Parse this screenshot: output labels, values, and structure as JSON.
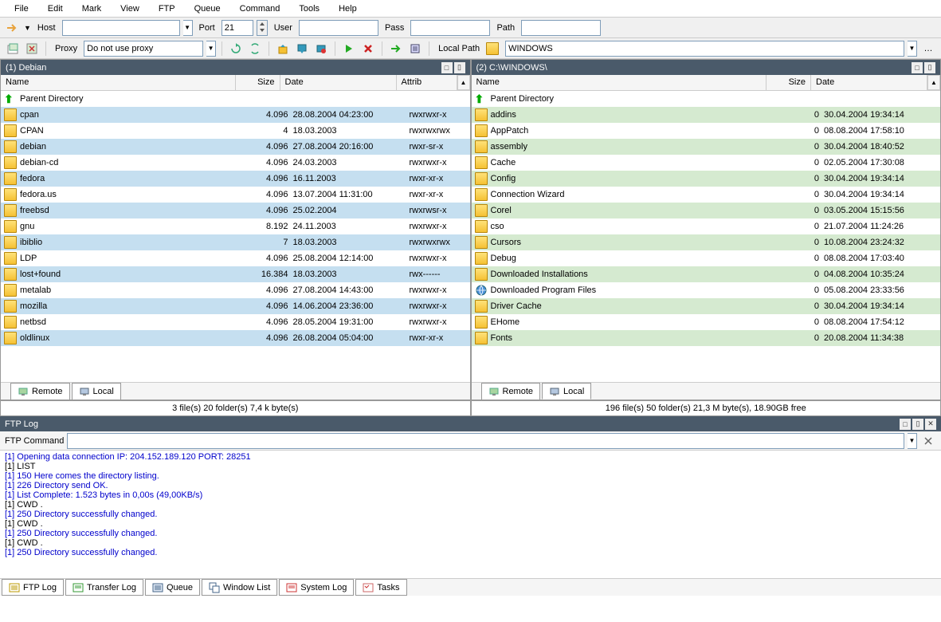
{
  "menu": {
    "file": "File",
    "edit": "Edit",
    "mark": "Mark",
    "view": "View",
    "ftp": "FTP",
    "queue": "Queue",
    "command": "Command",
    "tools": "Tools",
    "help": "Help"
  },
  "toolbar1": {
    "host": "Host",
    "port": "Port",
    "port_val": "21",
    "user": "User",
    "pass": "Pass",
    "path": "Path"
  },
  "toolbar2": {
    "proxy": "Proxy",
    "proxy_val": "Do not use proxy",
    "local_path": "Local Path",
    "local_path_val": "WINDOWS"
  },
  "left": {
    "title": "(1) Debian",
    "cols": {
      "name": "Name",
      "size": "Size",
      "date": "Date",
      "attrib": "Attrib"
    },
    "parent": "Parent Directory",
    "rows": [
      {
        "name": "cpan",
        "size": "4.096",
        "date": "28.08.2004 04:23:00",
        "attrib": "rwxrwxr-x"
      },
      {
        "name": "CPAN",
        "size": "4",
        "date": "18.03.2003",
        "attrib": "rwxrwxrwx"
      },
      {
        "name": "debian",
        "size": "4.096",
        "date": "27.08.2004 20:16:00",
        "attrib": "rwxr-sr-x"
      },
      {
        "name": "debian-cd",
        "size": "4.096",
        "date": "24.03.2003",
        "attrib": "rwxrwxr-x"
      },
      {
        "name": "fedora",
        "size": "4.096",
        "date": "16.11.2003",
        "attrib": "rwxr-xr-x"
      },
      {
        "name": "fedora.us",
        "size": "4.096",
        "date": "13.07.2004 11:31:00",
        "attrib": "rwxr-xr-x"
      },
      {
        "name": "freebsd",
        "size": "4.096",
        "date": "25.02.2004",
        "attrib": "rwxrwsr-x"
      },
      {
        "name": "gnu",
        "size": "8.192",
        "date": "24.11.2003",
        "attrib": "rwxrwxr-x"
      },
      {
        "name": "ibiblio",
        "size": "7",
        "date": "18.03.2003",
        "attrib": "rwxrwxrwx"
      },
      {
        "name": "LDP",
        "size": "4.096",
        "date": "25.08.2004 12:14:00",
        "attrib": "rwxrwxr-x"
      },
      {
        "name": "lost+found",
        "size": "16.384",
        "date": "18.03.2003",
        "attrib": "rwx------"
      },
      {
        "name": "metalab",
        "size": "4.096",
        "date": "27.08.2004 14:43:00",
        "attrib": "rwxrwxr-x"
      },
      {
        "name": "mozilla",
        "size": "4.096",
        "date": "14.06.2004 23:36:00",
        "attrib": "rwxrwxr-x"
      },
      {
        "name": "netbsd",
        "size": "4.096",
        "date": "28.05.2004 19:31:00",
        "attrib": "rwxrwxr-x"
      },
      {
        "name": "oldlinux",
        "size": "4.096",
        "date": "26.08.2004 05:04:00",
        "attrib": "rwxr-xr-x"
      }
    ],
    "tabs": {
      "remote": "Remote",
      "local": "Local"
    },
    "status": "3 file(s) 20 folder(s) 7,4 k byte(s)"
  },
  "right": {
    "title": "(2) C:\\WINDOWS\\",
    "cols": {
      "name": "Name",
      "size": "Size",
      "date": "Date"
    },
    "parent": "Parent Directory",
    "rows": [
      {
        "name": "addins",
        "size": "0",
        "date": "30.04.2004 19:34:14"
      },
      {
        "name": "AppPatch",
        "size": "0",
        "date": "08.08.2004 17:58:10"
      },
      {
        "name": "assembly",
        "size": "0",
        "date": "30.04.2004 18:40:52"
      },
      {
        "name": "Cache",
        "size": "0",
        "date": "02.05.2004 17:30:08"
      },
      {
        "name": "Config",
        "size": "0",
        "date": "30.04.2004 19:34:14"
      },
      {
        "name": "Connection Wizard",
        "size": "0",
        "date": "30.04.2004 19:34:14"
      },
      {
        "name": "Corel",
        "size": "0",
        "date": "03.05.2004 15:15:56"
      },
      {
        "name": "cso",
        "size": "0",
        "date": "21.07.2004 11:24:26"
      },
      {
        "name": "Cursors",
        "size": "0",
        "date": "10.08.2004 23:24:32"
      },
      {
        "name": "Debug",
        "size": "0",
        "date": "08.08.2004 17:03:40"
      },
      {
        "name": "Downloaded Installations",
        "size": "0",
        "date": "04.08.2004 10:35:24"
      },
      {
        "name": "Downloaded Program Files",
        "size": "0",
        "date": "05.08.2004 23:33:56"
      },
      {
        "name": "Driver Cache",
        "size": "0",
        "date": "30.04.2004 19:34:14"
      },
      {
        "name": "EHome",
        "size": "0",
        "date": "08.08.2004 17:54:12"
      },
      {
        "name": "Fonts",
        "size": "0",
        "date": "20.08.2004 11:34:38"
      }
    ],
    "tabs": {
      "remote": "Remote",
      "local": "Local"
    },
    "status": "196 file(s) 50 folder(s) 21,3 M byte(s), 18.90GB free"
  },
  "log": {
    "title": "FTP Log",
    "cmd_label": "FTP Command",
    "lines": [
      {
        "cls": "blue",
        "txt": "[1] Opening data connection IP: 204.152.189.120 PORT: 28251"
      },
      {
        "cls": "black",
        "txt": "[1] LIST"
      },
      {
        "cls": "blue",
        "txt": "[1] 150 Here comes the directory listing."
      },
      {
        "cls": "blue",
        "txt": "[1] 226 Directory send OK."
      },
      {
        "cls": "blue",
        "txt": "[1] List Complete: 1.523 bytes in 0,00s (49,00KB/s)"
      },
      {
        "cls": "black",
        "txt": "[1] CWD ."
      },
      {
        "cls": "blue",
        "txt": "[1] 250 Directory successfully changed."
      },
      {
        "cls": "black",
        "txt": "[1] CWD ."
      },
      {
        "cls": "blue",
        "txt": "[1] 250 Directory successfully changed."
      },
      {
        "cls": "black",
        "txt": "[1] CWD ."
      },
      {
        "cls": "blue",
        "txt": "[1] 250 Directory successfully changed."
      }
    ]
  },
  "bottom": {
    "ftp_log": "FTP Log",
    "transfer": "Transfer Log",
    "queue": "Queue",
    "window": "Window List",
    "system": "System Log",
    "tasks": "Tasks"
  }
}
